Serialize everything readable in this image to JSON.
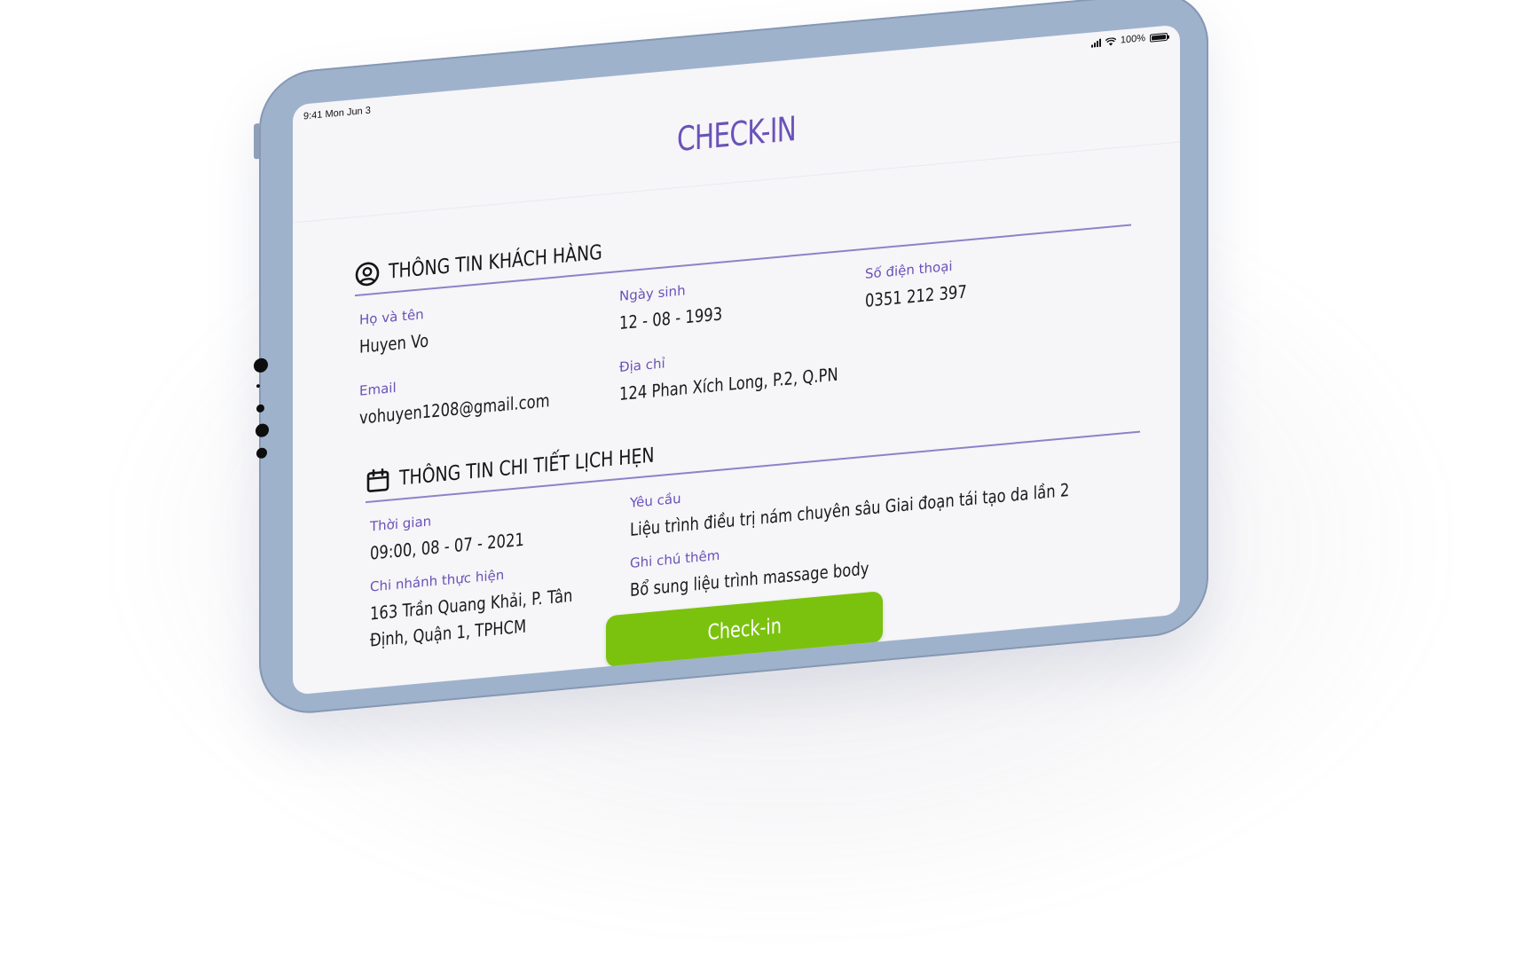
{
  "status_bar": {
    "time": "9:41",
    "date": "Mon Jun 3",
    "battery": "100%"
  },
  "page_title": "CHECK-IN",
  "customer_section": {
    "title": "THÔNG TIN KHÁCH HÀNG",
    "icon": "user-circle-icon",
    "fields": {
      "name_label": "Họ và tên",
      "name_value": "Huyen Vo",
      "dob_label": "Ngày sinh",
      "dob_value": "12 - 08 - 1993",
      "phone_label": "Số điện thoại",
      "phone_value": "0351 212 397",
      "email_label": "Email",
      "email_value": "vohuyen1208@gmail.com",
      "address_label": "Địa chỉ",
      "address_value": "124 Phan Xích Long, P.2, Q.PN"
    }
  },
  "appointment_section": {
    "title": "THÔNG TIN CHI TIẾT LỊCH HẸN",
    "icon": "calendar-icon",
    "fields": {
      "time_label": "Thời gian",
      "time_value": "09:00, 08 - 07 - 2021",
      "branch_label": "Chi nhánh thực hiện",
      "branch_value": "163 Trần Quang Khải, P. Tân Định, Quận 1, TPHCM",
      "request_label": "Yêu cầu",
      "request_value": "Liệu trình điều trị nám chuyên sâu Giai đoạn tái tạo da lần 2",
      "note_label": "Ghi chú thêm",
      "note_value": "Bổ sung liệu trình massage body"
    }
  },
  "checkin_button_label": "Check-in",
  "colors": {
    "accent": "#6a52b8",
    "button": "#7bc20f",
    "device_frame": "#9fb2cc",
    "screen_bg": "#f6f5f8"
  }
}
